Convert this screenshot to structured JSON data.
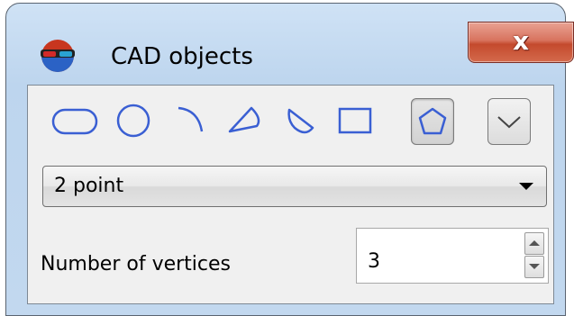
{
  "window": {
    "title": "CAD objects",
    "close_label": "x"
  },
  "toolbar": {
    "tools": [
      {
        "icon": "ellipse-icon",
        "label": ""
      },
      {
        "icon": "circle-icon",
        "label": ""
      },
      {
        "icon": "arc-icon",
        "label": ""
      },
      {
        "icon": "sector-icon",
        "label": ""
      },
      {
        "icon": "segment-icon",
        "label": ""
      },
      {
        "icon": "rectangle-icon",
        "label": ""
      },
      {
        "icon": "polygon-icon",
        "label": "",
        "selected": true
      },
      {
        "icon": "chevron-down-icon",
        "label": ""
      }
    ],
    "accent_color": "#3a5fd3"
  },
  "mode": {
    "selected": "2 point"
  },
  "vertices": {
    "label": "Number of vertices",
    "value": "3"
  }
}
